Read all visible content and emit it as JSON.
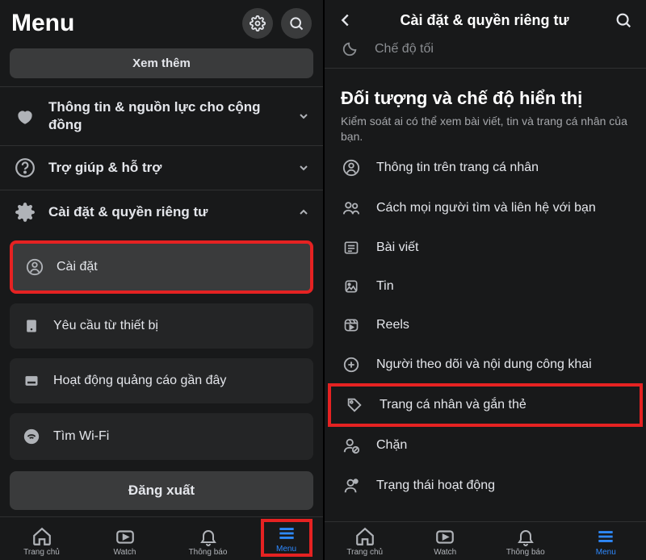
{
  "left": {
    "title": "Menu",
    "see_more": "Xem thêm",
    "rows": {
      "community": "Thông tin & nguồn lực cho cộng đồng",
      "help": "Trợ giúp & hỗ trợ",
      "settings_privacy": "Cài đặt & quyền riêng tư"
    },
    "sub": {
      "settings": "Cài đặt",
      "device_requests": "Yêu cầu từ thiết bị",
      "recent_ad": "Hoạt động quảng cáo gần đây",
      "find_wifi": "Tìm Wi-Fi"
    },
    "logout": "Đăng xuất",
    "tabs": {
      "home": "Trang chủ",
      "watch": "Watch",
      "notifications": "Thông báo",
      "menu": "Menu"
    }
  },
  "right": {
    "header": "Cài đặt & quyền riêng tư",
    "cutoff": "Chế độ tối",
    "section_title": "Đối tượng và chế độ hiển thị",
    "section_desc": "Kiểm soát ai có thể xem bài viết, tin và trang cá nhân của bạn.",
    "items": {
      "profile_info": "Thông tin trên trang cá nhân",
      "how_people_find": "Cách mọi người tìm và liên hệ với bạn",
      "posts": "Bài viết",
      "stories": "Tin",
      "reels": "Reels",
      "followers": "Người theo dõi và nội dung công khai",
      "profile_tagging": "Trang cá nhân và gắn thẻ",
      "blocking": "Chặn",
      "active_status": "Trạng thái hoạt động"
    },
    "tabs": {
      "home": "Trang chủ",
      "watch": "Watch",
      "notifications": "Thông báo",
      "menu": "Menu"
    }
  }
}
